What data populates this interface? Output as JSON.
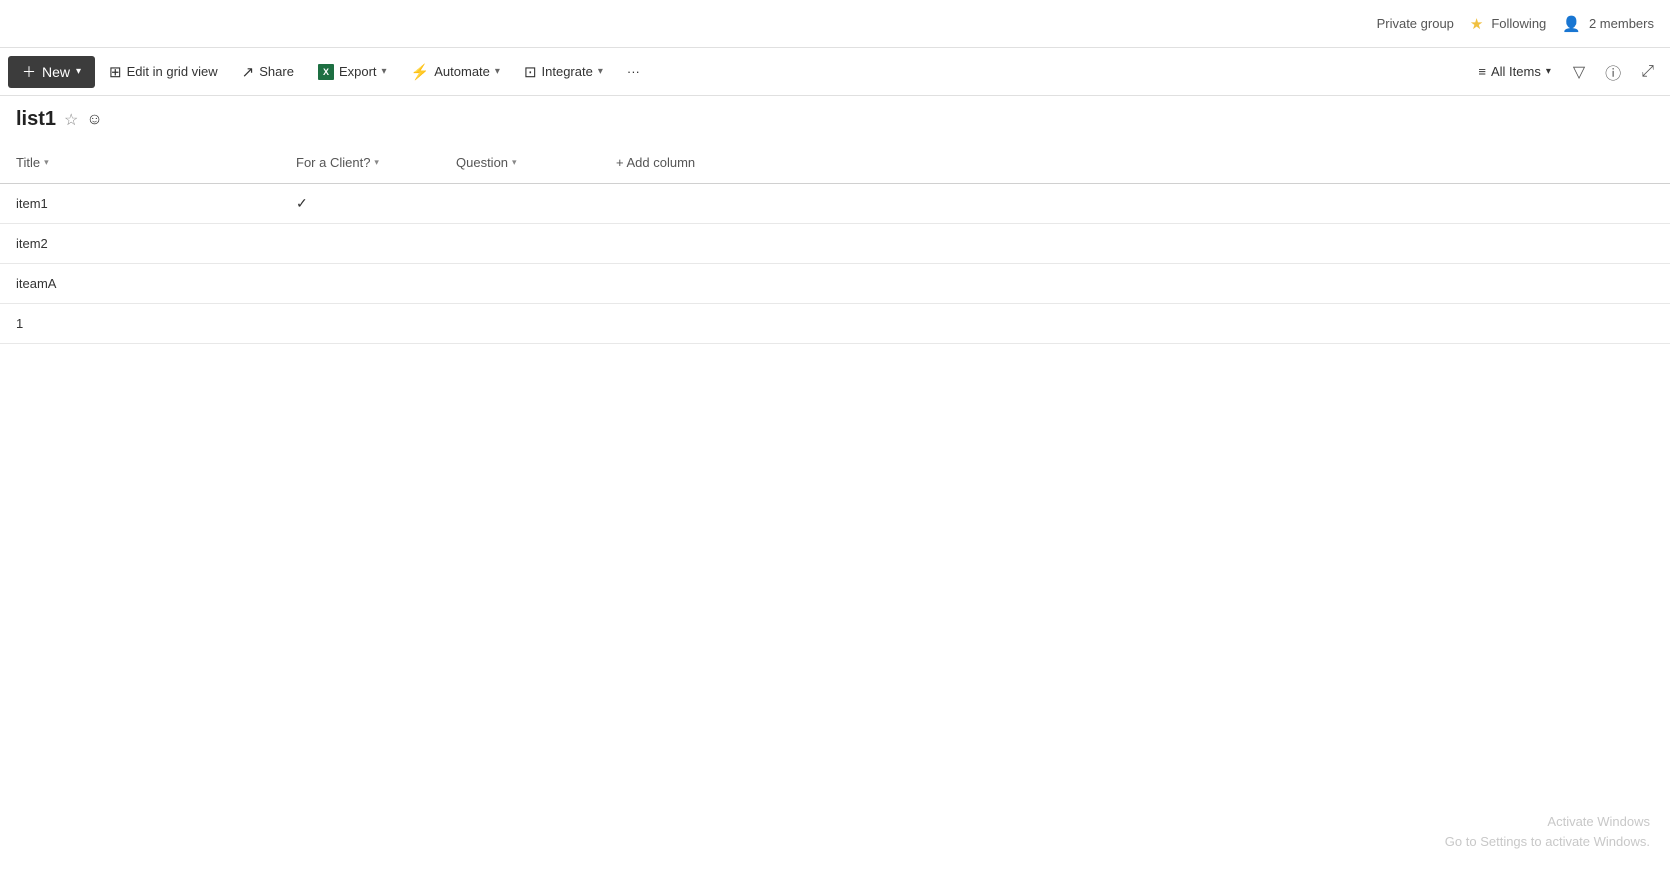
{
  "topbar": {
    "private_group_label": "Private group",
    "following_label": "Following",
    "members_label": "2 members"
  },
  "toolbar": {
    "new_label": "New",
    "edit_grid_label": "Edit in grid view",
    "share_label": "Share",
    "export_label": "Export",
    "automate_label": "Automate",
    "integrate_label": "Integrate",
    "more_label": "···",
    "all_items_label": "All Items",
    "filter_icon": "⊟",
    "info_icon": "ⓘ",
    "expand_icon": "⤢"
  },
  "page": {
    "title": "list1"
  },
  "columns": [
    {
      "label": "Title",
      "key": "title"
    },
    {
      "label": "For a Client?",
      "key": "client"
    },
    {
      "label": "Question",
      "key": "question"
    }
  ],
  "add_column_label": "+ Add column",
  "rows": [
    {
      "title": "item1",
      "client": true,
      "question": ""
    },
    {
      "title": "item2",
      "client": false,
      "question": ""
    },
    {
      "title": "iteamA",
      "client": false,
      "question": ""
    },
    {
      "title": "1",
      "client": false,
      "question": ""
    }
  ],
  "watermark": {
    "line1": "Activate Windows",
    "line2": "Go to Settings to activate Windows."
  }
}
